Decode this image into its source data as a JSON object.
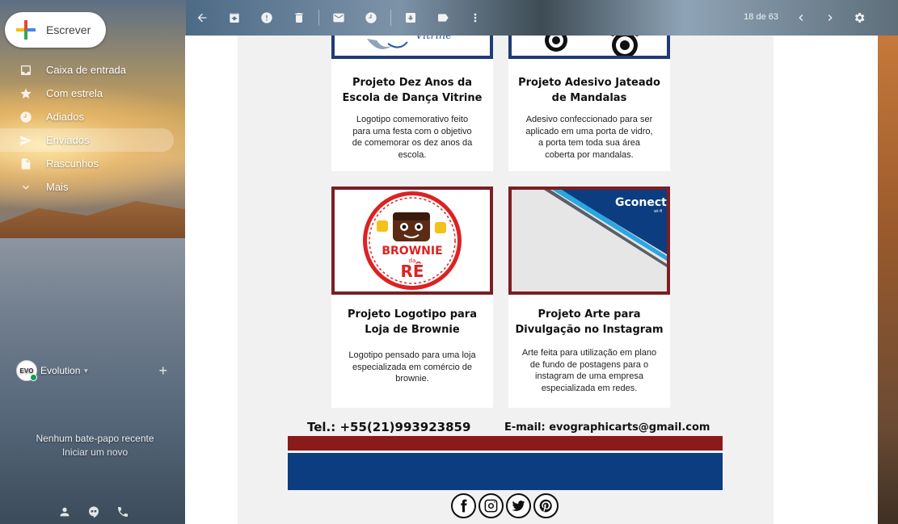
{
  "compose": {
    "label": "Escrever"
  },
  "nav": {
    "items": [
      {
        "label": "Caixa de entrada",
        "icon": "inbox-icon"
      },
      {
        "label": "Com estrela",
        "icon": "star-icon"
      },
      {
        "label": "Adiados",
        "icon": "clock-icon"
      },
      {
        "label": "Enviados",
        "icon": "send-icon",
        "active": true
      },
      {
        "label": "Rascunhos",
        "icon": "draft-icon"
      },
      {
        "label": "Mais",
        "icon": "chevron-down-icon"
      }
    ]
  },
  "hangouts": {
    "avatar_text": "EVO",
    "user": "Evolution",
    "empty": "Nenhum bate-papo recente",
    "start_new": "Iniciar um novo"
  },
  "toolbar": {
    "count": "18 de 63"
  },
  "email": {
    "cards": [
      {
        "title": "Projeto Dez Anos da Escola de Dança Vitrine",
        "desc": "Logotipo comemorativo feito para uma festa com o objetivo de comemorar os dez anos da escola.",
        "image_text": "Vitrine"
      },
      {
        "title": "Projeto Adesivo Jateado de Mandalas",
        "desc": "Adesivo confeccionado para ser aplicado em uma porta de vidro, a porta tem toda sua área coberta por mandalas."
      },
      {
        "title": "Projeto Logotipo para Loja de Brownie",
        "desc": "Logotipo pensado para uma loja especializada em comércio de brownie.",
        "logo_text_top": "BROWNIE",
        "logo_text_mid": "da",
        "logo_text_bottom": "RÊ"
      },
      {
        "title": "Projeto Arte para Divulgação no Instagram",
        "desc": "Arte feita para utilização em plano de fundo de postagens para o instagram de uma empresa especializada em redes.",
        "logo_text": "Gconect",
        "logo_sub": "wi-fi"
      }
    ],
    "contact": {
      "tel": "Tel.: +55(21)993923859",
      "email": "E-mail: evographicarts@gmail.com"
    },
    "colors": {
      "red": "#8b1a1d",
      "blue": "#0b3d80"
    },
    "social": [
      "facebook-icon",
      "instagram-icon",
      "twitter-icon",
      "pinterest-icon"
    ]
  }
}
